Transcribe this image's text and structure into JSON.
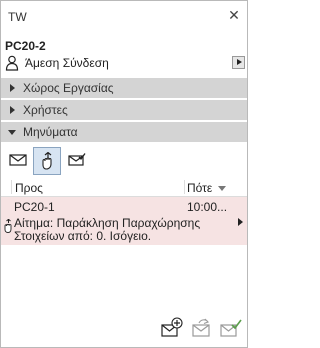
{
  "window": {
    "title": "TW"
  },
  "project": {
    "name": "PC20-2"
  },
  "user": {
    "status": "Άμεση Σύνδεση"
  },
  "sections": [
    {
      "label": "Χώρος Εργασίας",
      "expanded": false
    },
    {
      "label": "Χρήστες",
      "expanded": false
    },
    {
      "label": "Μηνύματα",
      "expanded": true
    }
  ],
  "message_tools": [
    {
      "icon": "envelope-icon",
      "active": false
    },
    {
      "icon": "hand-request-icon",
      "active": true
    },
    {
      "icon": "checked-envelope-icon",
      "active": false
    }
  ],
  "messages": {
    "columns": [
      "Προς",
      "Πότε"
    ],
    "rows": [
      {
        "sender": "PC20-1",
        "time": "10:00...",
        "text": "Αίτημα: Παράκληση Παραχώρησης Στοιχείων από: 0. Ισόγειο."
      }
    ]
  },
  "bottom_tools": [
    "new-message-icon",
    "reply-icon",
    "acknowledge-icon"
  ],
  "colors": {
    "section_bg": "#d4d4d4",
    "selected_row_bg": "#f6e3e3",
    "active_tool_bg": "#d7e4f2"
  }
}
